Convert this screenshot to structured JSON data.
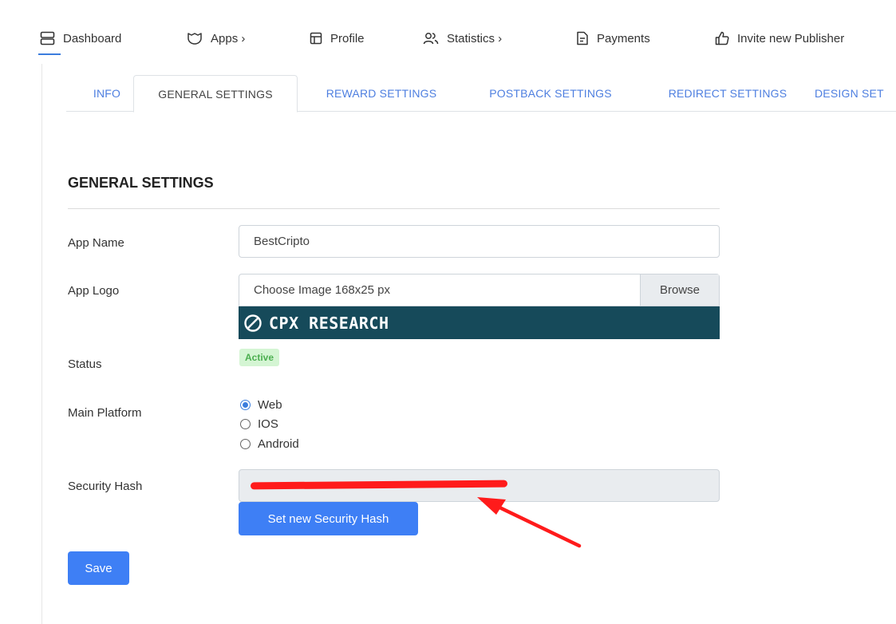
{
  "nav": {
    "items": [
      {
        "label": "Dashboard",
        "icon": "server-icon",
        "active": true
      },
      {
        "label": "Apps ›",
        "icon": "apps-icon"
      },
      {
        "label": "Profile",
        "icon": "layout-icon"
      },
      {
        "label": "Statistics ›",
        "icon": "users-icon"
      },
      {
        "label": "Payments",
        "icon": "file-icon"
      },
      {
        "label": "Invite new Publisher",
        "icon": "thumbs-up-icon"
      }
    ]
  },
  "tabs": [
    "INFO",
    "GENERAL SETTINGS",
    "REWARD SETTINGS",
    "POSTBACK SETTINGS",
    "REDIRECT SETTINGS",
    "DESIGN SET"
  ],
  "active_tab": "GENERAL SETTINGS",
  "section_title": "GENERAL SETTINGS",
  "form": {
    "app_name_label": "App Name",
    "app_name_value": "BestCripto",
    "app_logo_label": "App Logo",
    "logo_placeholder": "Choose Image 168x25 px",
    "browse_label": "Browse",
    "logo_text": "CPX RESEARCH",
    "status_label": "Status",
    "status_value": "Active",
    "platform_label": "Main Platform",
    "platform_options": [
      "Web",
      "IOS",
      "Android"
    ],
    "platform_selected": "Web",
    "security_hash_label": "Security Hash",
    "set_hash_button": "Set new Security Hash",
    "save_button": "Save"
  },
  "colors": {
    "accent": "#3e7ff5",
    "tab_link": "#4e7fe0",
    "logo_bg": "#164a5a",
    "status_bg": "#d4f5d3",
    "status_text": "#4caf50",
    "annotation": "#ff1b1b"
  }
}
